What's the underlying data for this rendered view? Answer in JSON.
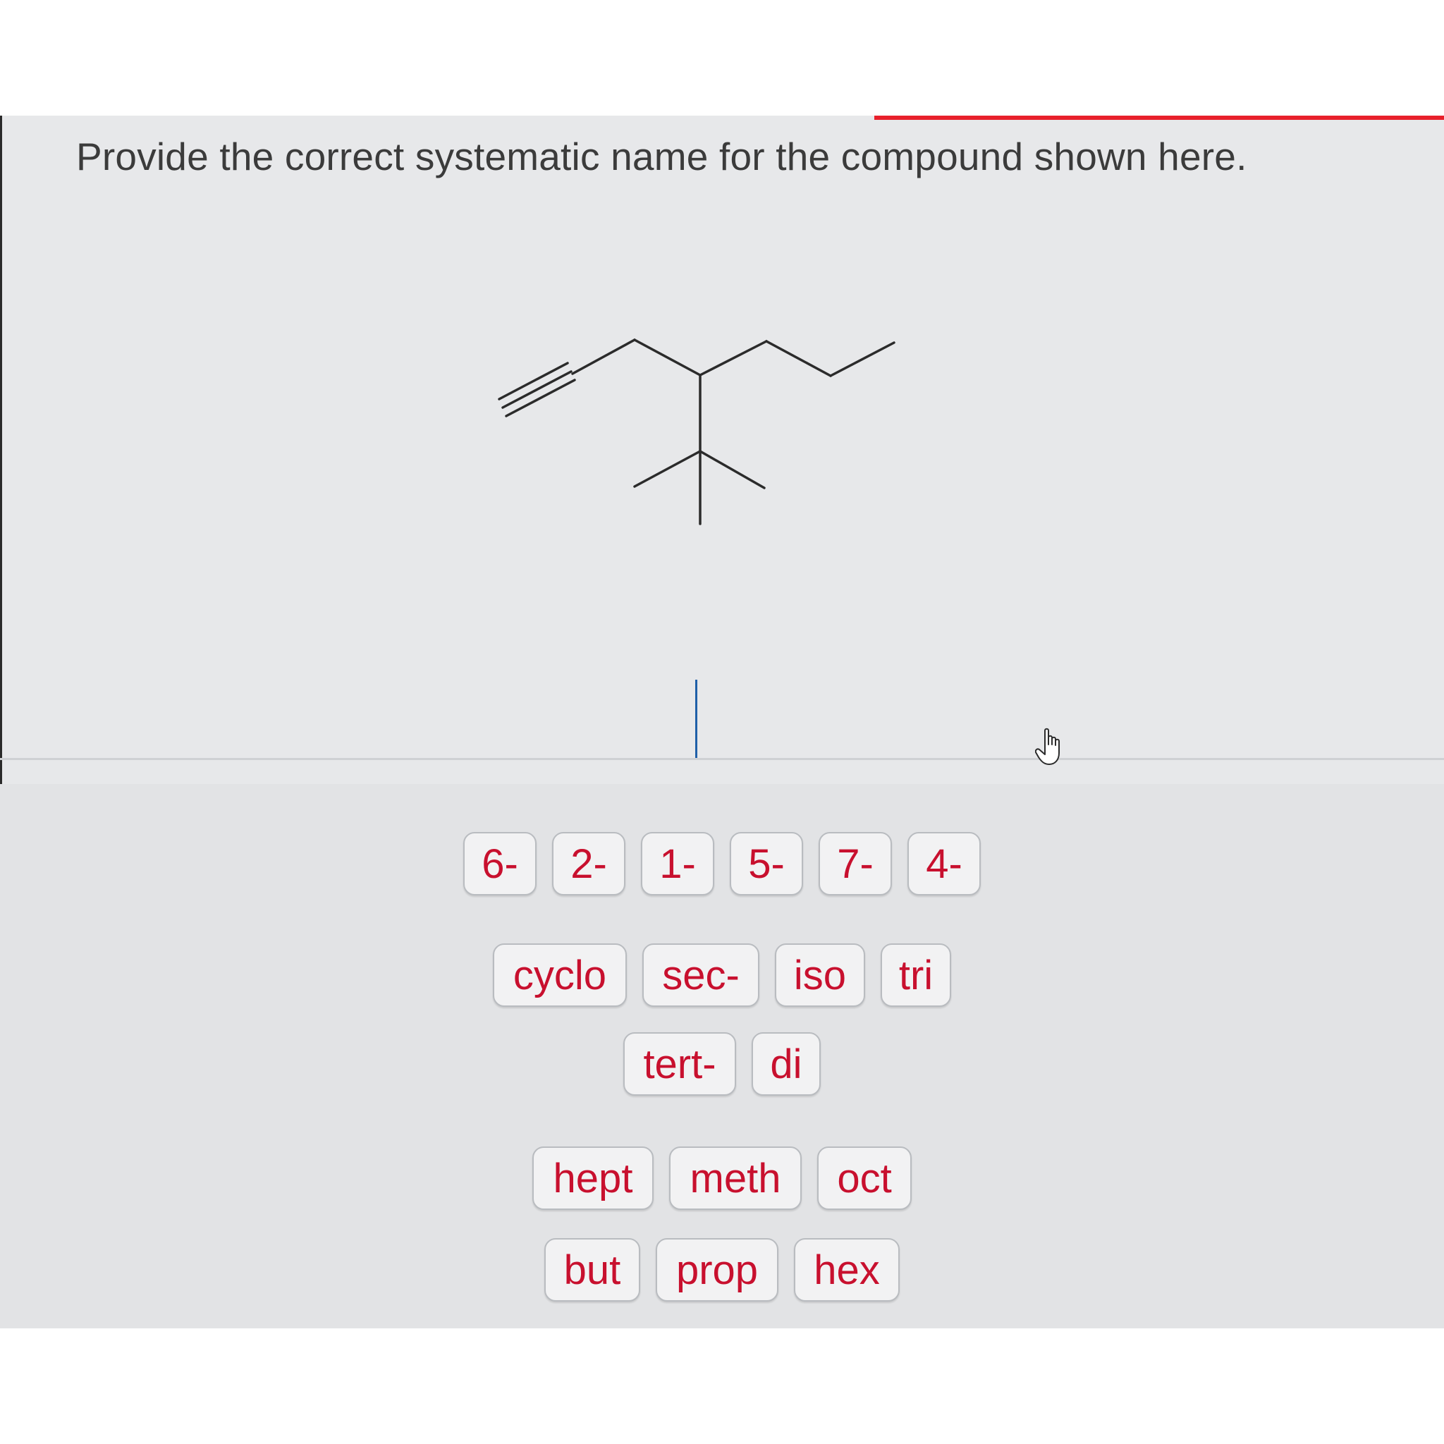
{
  "question": {
    "text": "Provide the correct systematic name for the compound shown here."
  },
  "answer": {
    "value": ""
  },
  "tiles": {
    "locants": [
      "6-",
      "2-",
      "1-",
      "5-",
      "7-",
      "4-"
    ],
    "prefixes_row1": [
      "cyclo",
      "sec-",
      "iso",
      "tri"
    ],
    "prefixes_row2": [
      "tert-",
      "di"
    ],
    "roots_row1": [
      "hept",
      "meth",
      "oct"
    ],
    "roots_row2": [
      "but",
      "prop",
      "hex"
    ]
  },
  "icons": {
    "cursor": "pointing-hand-icon",
    "structure": "skeletal-structure-diagram"
  },
  "colors": {
    "accent": "#e8202b",
    "tile_text": "#c8102e",
    "caret": "#1f5fa8"
  }
}
